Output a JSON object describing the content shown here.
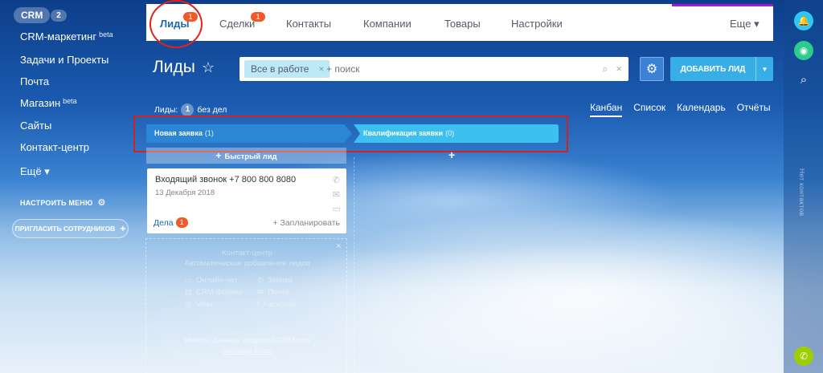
{
  "left_menu": {
    "crm_label": "CRM",
    "crm_count": "2",
    "items": [
      {
        "label": "CRM-маркетинг",
        "tag": "beta"
      },
      {
        "label": "Задачи и Проекты",
        "tag": ""
      },
      {
        "label": "Почта",
        "tag": ""
      },
      {
        "label": "Магазин",
        "tag": "beta"
      },
      {
        "label": "Сайты",
        "tag": ""
      },
      {
        "label": "Контакт-центр",
        "tag": ""
      },
      {
        "label": "Ещё ▾",
        "tag": ""
      }
    ],
    "configure_label": "НАСТРОИТЬ МЕНЮ",
    "invite_label": "ПРИГЛАСИТЬ СОТРУДНИКОВ"
  },
  "topnav": {
    "tabs": [
      {
        "label": "Лиды",
        "badge": "1"
      },
      {
        "label": "Сделки",
        "badge": "1"
      },
      {
        "label": "Контакты",
        "badge": ""
      },
      {
        "label": "Компании",
        "badge": ""
      },
      {
        "label": "Товары",
        "badge": ""
      },
      {
        "label": "Настройки",
        "badge": ""
      }
    ],
    "more_label": "Еще ▾"
  },
  "page": {
    "title": "Лиды",
    "filter_tag": "Все в работе",
    "search_placeholder": "+ поиск",
    "add_button": "ДОБАВИТЬ ЛИД",
    "leads_label": "Лиды:",
    "leads_count": "1",
    "leads_suffix": "без дел",
    "views": [
      "Канбан",
      "Список",
      "Календарь",
      "Отчёты"
    ]
  },
  "kanban": {
    "stages": [
      {
        "name": "Новая заявка",
        "count": "(1)"
      },
      {
        "name": "Квалификация заявки",
        "count": "(0)"
      }
    ],
    "quick_lead": "Быстрый лид",
    "card": {
      "title": "Входящий звонок +7 800 800 8080",
      "date": "13 Декабря 2018",
      "deals_label": "Дела",
      "deals_count": "1",
      "plan_label": "+ Запланировать"
    },
    "empty": {
      "line1": "Контакт-центр",
      "line2": "Автоматическое добавление лидов",
      "channels": [
        "Онлайн-чат",
        "Звонки",
        "CRM-формы",
        "Почта",
        "Viber",
        "Facebook"
      ],
      "import_text": "Импорт данных из другой CRM или",
      "import_link": "таблицы Excel"
    }
  },
  "right_bar": {
    "no_contacts": "Нет контактов"
  },
  "colors": {
    "accent": "#2067b0",
    "badge": "#f05a2a",
    "stage_new": "#2b87d6",
    "stage_qual": "#3cc0f0",
    "add_button": "#38aee8",
    "highlight": "#cf2222"
  }
}
